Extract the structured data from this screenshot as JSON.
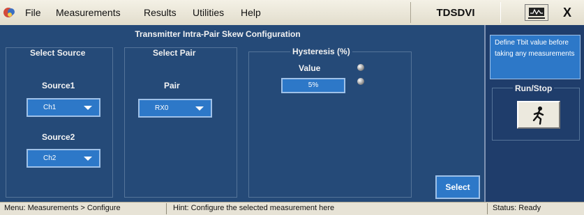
{
  "menu": {
    "items": [
      {
        "label": "File"
      },
      {
        "label": "Measurements"
      },
      {
        "label": "Results"
      },
      {
        "label": "Utilities"
      },
      {
        "label": "Help"
      }
    ],
    "app_name": "TDSDVI",
    "close_label": "X"
  },
  "config": {
    "title": "Transmitter Intra-Pair Skew Configuration",
    "source_group": {
      "title": "Select Source",
      "source1_label": "Source1",
      "source1_value": "Ch1",
      "source2_label": "Source2",
      "source2_value": "Ch2"
    },
    "pair_group": {
      "title": "Select Pair",
      "pair_label": "Pair",
      "pair_value": "RX0"
    },
    "hysteresis_group": {
      "title": "Hysteresis (%)",
      "value_label": "Value",
      "value": "5%"
    },
    "select_button": "Select"
  },
  "side_panel": {
    "info_text": "Define Tbit value before taking any measurements",
    "runstop_title": "Run/Stop"
  },
  "status_bar": {
    "menu_path": "Menu: Measurements > Configure",
    "hint": "Hint: Configure the selected measurement here",
    "status": "Status: Ready"
  },
  "colors": {
    "panel_bg": "#254a78",
    "control_blue": "#2d78c8",
    "menubar_bg": "#ece9de"
  },
  "icons": [
    "app-logo-icon",
    "chevron-down-icon",
    "knob-icon",
    "waveform-icon",
    "running-figure-icon"
  ]
}
